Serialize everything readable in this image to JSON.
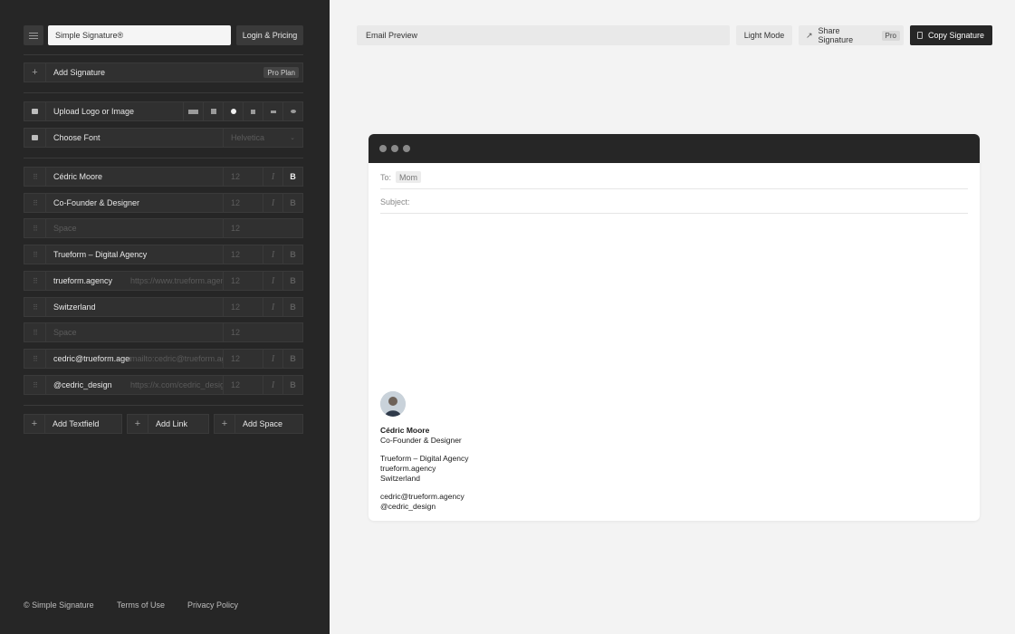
{
  "sidebar": {
    "site_title": "Simple Signature®",
    "login_label": "Login & Pricing",
    "add_signature": {
      "label": "Add Signature",
      "badge": "Pro Plan"
    },
    "upload": {
      "label": "Upload Logo or Image"
    },
    "font": {
      "label": "Choose Font",
      "value": "Helvetica"
    },
    "fields": [
      {
        "text": "Cédric Moore",
        "link": "",
        "size": "12",
        "bold_active": true,
        "type": "text"
      },
      {
        "text": "Co-Founder & Designer",
        "link": "",
        "size": "12",
        "bold_active": false,
        "type": "text"
      },
      {
        "text": "Space",
        "link": "",
        "size": "12",
        "bold_active": false,
        "type": "space"
      },
      {
        "text": "Trueform – Digital Agency",
        "link": "",
        "size": "12",
        "bold_active": false,
        "type": "text"
      },
      {
        "text": "trueform.agency",
        "link": "https://www.trueform.agency",
        "size": "12",
        "bold_active": false,
        "type": "link"
      },
      {
        "text": "Switzerland",
        "link": "",
        "size": "12",
        "bold_active": false,
        "type": "text"
      },
      {
        "text": "Space",
        "link": "",
        "size": "12",
        "bold_active": false,
        "type": "space"
      },
      {
        "text": "cedric@trueform.agency",
        "link": "mailto:cedric@trueform.agency",
        "size": "12",
        "bold_active": false,
        "type": "link"
      },
      {
        "text": "@cedric_design",
        "link": "https://x.com/cedric_design",
        "size": "12",
        "bold_active": false,
        "type": "link"
      }
    ],
    "add_textfield": "Add Textfield",
    "add_link": "Add Link",
    "add_space": "Add Space",
    "footer": {
      "copyright": "© Simple Signature",
      "terms": "Terms of Use",
      "privacy": "Privacy Policy"
    }
  },
  "toolbar": {
    "email_preview": "Email Preview",
    "light_mode": "Light Mode",
    "share": "Share Signature",
    "share_badge": "Pro",
    "copy": "Copy Signature"
  },
  "email": {
    "to_label": "To:",
    "to_value": "Mom",
    "subject_label": "Subject:",
    "signature": {
      "name": "Cédric Moore",
      "title": "Co-Founder & Designer",
      "company": "Trueform – Digital Agency",
      "website": "trueform.agency",
      "country": "Switzerland",
      "email": "cedric@trueform.agency",
      "social": "@cedric_design"
    }
  },
  "colors": {
    "sidebar_bg": "#262626",
    "main_bg": "#f3f3f3",
    "accent_dark": "#262626"
  }
}
